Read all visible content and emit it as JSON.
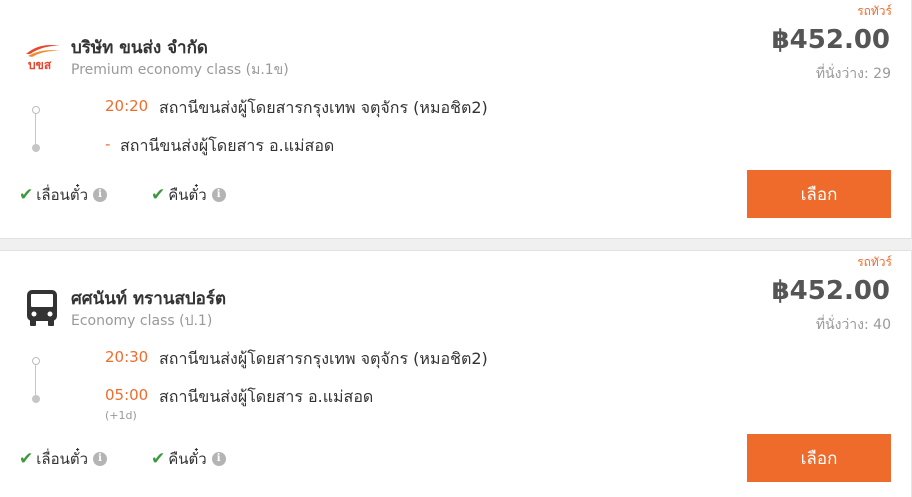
{
  "trips": [
    {
      "operator": "บริษัท ขนส่ง จำกัด",
      "logo_text": "บขส",
      "bus_class": "Premium economy class (ม.1ข)",
      "tag": "รถทัวร์",
      "price": "฿452.00",
      "seats": "ที่นั่งว่าง: 29",
      "departure": {
        "time": "20:20",
        "station": "สถานีขนส่งผู้โดยสารกรุงเทพ จตุจักร (หมอชิต2)"
      },
      "arrival": {
        "time": "-",
        "station": "สถานีขนส่งผู้โดยสาร อ.แม่สอด",
        "day_offset": ""
      },
      "features": [
        "เลื่อนตั๋ว",
        "คืนตั๋ว"
      ],
      "select_label": "เลือก"
    },
    {
      "operator": "ศศนันท์ ทรานสปอร์ต",
      "bus_class": "Economy class (ป.1)",
      "tag": "รถทัวร์",
      "price": "฿452.00",
      "seats": "ที่นั่งว่าง: 40",
      "departure": {
        "time": "20:30",
        "station": "สถานีขนส่งผู้โดยสารกรุงเทพ จตุจักร (หมอชิต2)"
      },
      "arrival": {
        "time": "05:00",
        "station": "สถานีขนส่งผู้โดยสาร อ.แม่สอด",
        "day_offset": "(+1d)"
      },
      "features": [
        "เลื่อนตั๋ว",
        "คืนตั๋ว"
      ],
      "select_label": "เลือก"
    }
  ],
  "colors": {
    "accent": "#ef6b2b",
    "check": "#3e9a3e",
    "price": "#555555",
    "muted": "#999999"
  },
  "icons": {
    "info": "info-icon",
    "check": "check-icon",
    "bus": "bus-icon"
  }
}
